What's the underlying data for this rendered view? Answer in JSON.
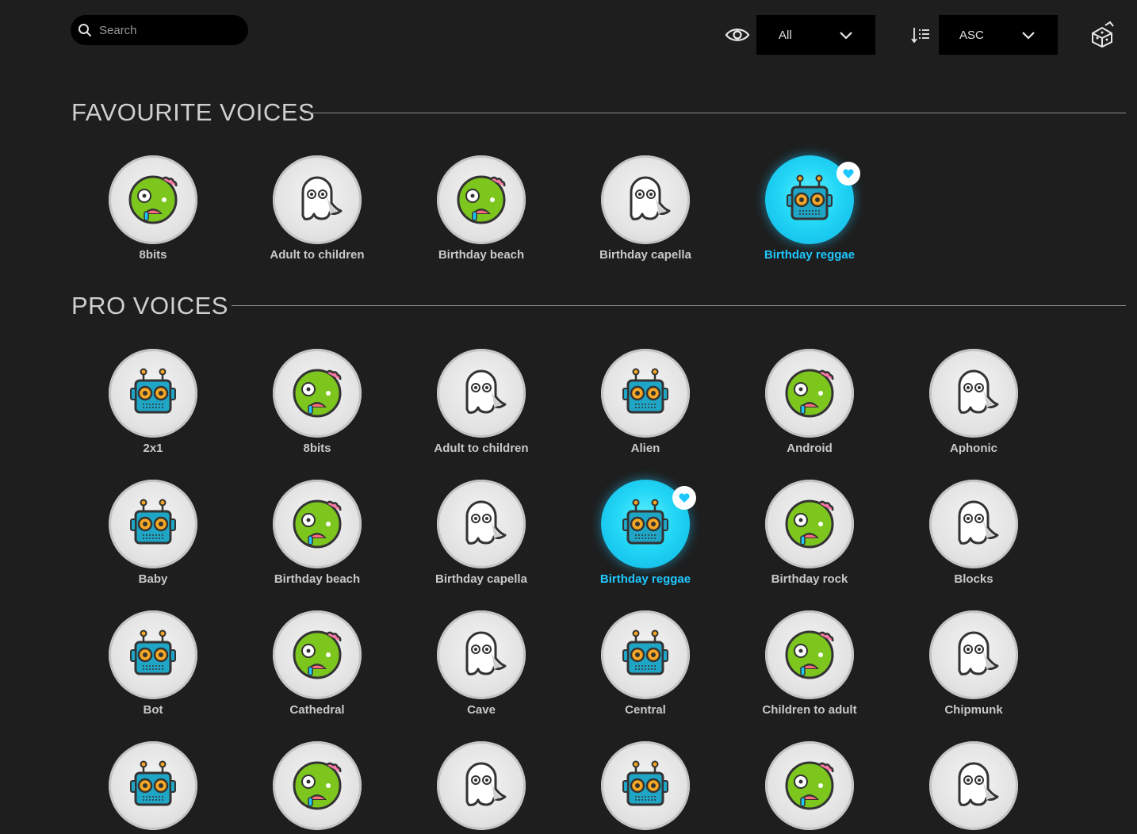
{
  "search": {
    "placeholder": "Search",
    "value": ""
  },
  "filter": {
    "selected": "All",
    "icon": "eye-icon"
  },
  "sort": {
    "selected": "ASC",
    "icon": "sort-icon"
  },
  "random": {
    "icon": "dice-icon"
  },
  "colors": {
    "background": "#1e1e1e",
    "accent": "#1ec8ff",
    "zombie": "#7cc61e",
    "robot": "#1fa6c6"
  },
  "favourites": {
    "title": "FAVOURITE VOICES",
    "items": [
      {
        "label": "8bits",
        "icon": "zombie",
        "selected": false
      },
      {
        "label": "Adult to children",
        "icon": "ghost",
        "selected": false
      },
      {
        "label": "Birthday beach",
        "icon": "zombie",
        "selected": false
      },
      {
        "label": "Birthday capella",
        "icon": "ghost",
        "selected": false
      },
      {
        "label": "Birthday reggae",
        "icon": "robot",
        "selected": true
      }
    ]
  },
  "pro": {
    "title": "PRO VOICES",
    "items": [
      {
        "label": "2x1",
        "icon": "robot",
        "selected": false
      },
      {
        "label": "8bits",
        "icon": "zombie",
        "selected": false
      },
      {
        "label": "Adult to children",
        "icon": "ghost",
        "selected": false
      },
      {
        "label": "Alien",
        "icon": "robot",
        "selected": false
      },
      {
        "label": "Android",
        "icon": "zombie",
        "selected": false
      },
      {
        "label": "Aphonic",
        "icon": "ghost",
        "selected": false
      },
      {
        "label": "Baby",
        "icon": "robot",
        "selected": false
      },
      {
        "label": "Birthday beach",
        "icon": "zombie",
        "selected": false
      },
      {
        "label": "Birthday capella",
        "icon": "ghost",
        "selected": false
      },
      {
        "label": "Birthday reggae",
        "icon": "robot",
        "selected": true
      },
      {
        "label": "Birthday rock",
        "icon": "zombie",
        "selected": false
      },
      {
        "label": "Blocks",
        "icon": "ghost",
        "selected": false
      },
      {
        "label": "Bot",
        "icon": "robot",
        "selected": false
      },
      {
        "label": "Cathedral",
        "icon": "zombie",
        "selected": false
      },
      {
        "label": "Cave",
        "icon": "ghost",
        "selected": false
      },
      {
        "label": "Central",
        "icon": "robot",
        "selected": false
      },
      {
        "label": "Children to adult",
        "icon": "zombie",
        "selected": false
      },
      {
        "label": "Chipmunk",
        "icon": "ghost",
        "selected": false
      },
      {
        "label": "",
        "icon": "robot",
        "selected": false
      },
      {
        "label": "",
        "icon": "zombie",
        "selected": false
      },
      {
        "label": "",
        "icon": "ghost",
        "selected": false
      },
      {
        "label": "",
        "icon": "robot",
        "selected": false
      },
      {
        "label": "",
        "icon": "zombie",
        "selected": false
      },
      {
        "label": "",
        "icon": "ghost",
        "selected": false
      }
    ]
  }
}
